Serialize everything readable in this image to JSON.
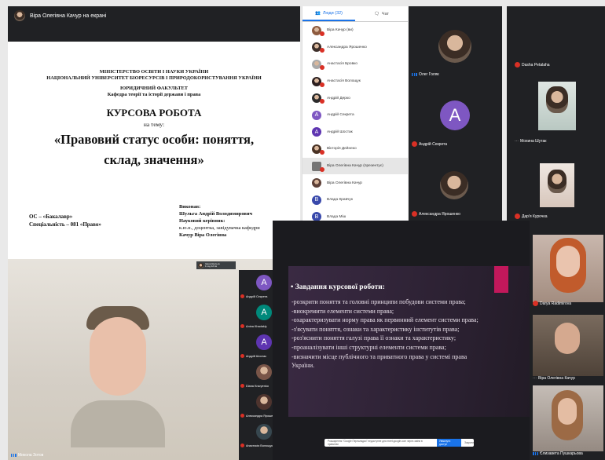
{
  "presenter": {
    "banner": "Віра Олегівна Качур на екрані"
  },
  "document": {
    "ministry": "МІНІСТЕРСТВО ОСВІТИ І НАУКИ УКРАЇНИ",
    "university": "НАЦІОНАЛЬНИЙ УНІВЕРСИТЕТ БІОРЕСУРСІВ І ПРИРОДОКОРИСТУВАННЯ УКРАЇНИ",
    "faculty": "ЮРИДИЧНИЙ ФАКУЛЬТЕТ",
    "department": "Кафедра теорії та історії держави і права",
    "work_type": "КУРСОВА РОБОТА",
    "on_topic": "на тему:",
    "topic_line1": "«Правовий статус особи: поняття,",
    "topic_line2": "склад, значення»",
    "degree": "ОС – «Бакалавр»",
    "specialty": "Спеціальність – 081 «Право»",
    "performed_label": "Виконав:",
    "student": "Шульга Андрій Володимирович",
    "supervisor_label": "Науковий керівник:",
    "supervisor_title": "к.ю.н., доцентка, завідувачка кафедри",
    "supervisor": "Качур Віра Олегівна"
  },
  "people_panel": {
    "tab_people": "Люди (32)",
    "tab_chat": "Чат",
    "items": [
      {
        "name": "Віра Качур (ви)",
        "type": "photo",
        "color": "#8d5b3f",
        "muted": true
      },
      {
        "name": "Александра Ярошенко",
        "type": "photo",
        "color": "#3d2f2a",
        "muted": true
      },
      {
        "name": "Анастасія Бровко",
        "type": "photo",
        "color": "#a9a9a9",
        "muted": true
      },
      {
        "name": "Анастасія Волощук",
        "type": "photo",
        "color": "#2d2020",
        "muted": true
      },
      {
        "name": "Андрій Дерко",
        "type": "photo",
        "color": "#2b2b2b",
        "muted": true
      },
      {
        "name": "Андрій Секрета",
        "type": "letter",
        "letter": "A",
        "color": "#7e57c2",
        "muted": true
      },
      {
        "name": "Андрій Шостак",
        "type": "letter",
        "letter": "A",
        "color": "#5e35b1",
        "muted": true
      },
      {
        "name": "Вікторія Дейнеко",
        "type": "photo",
        "color": "#4a3325",
        "muted": true
      },
      {
        "name": "Віра Олегівна Качур (презентує)",
        "type": "screen",
        "color": "#757575",
        "muted": true
      },
      {
        "name": "Віра Олегівна Качур",
        "type": "photo",
        "color": "#5d4037",
        "muted": false
      },
      {
        "name": "Влада Кравчук",
        "type": "letter",
        "letter": "B",
        "color": "#3949ab",
        "muted": true
      },
      {
        "name": "Влада Міш",
        "type": "letter",
        "letter": "B",
        "color": "#3949ab",
        "muted": true
      }
    ]
  },
  "grid_mid": {
    "tiles": [
      {
        "name": "Олег Голяк",
        "letter": "",
        "color": "#4e342e"
      },
      {
        "name": "Андрій Секрета",
        "letter": "A",
        "color": "#7e57c2"
      },
      {
        "name": "Александра Ярошенко",
        "letter": "",
        "color": "#3e2723"
      }
    ]
  },
  "grid_right": {
    "tiles": [
      {
        "name": "Dasha Petalaha"
      },
      {
        "name": "Мохина Шутак"
      },
      {
        "name": "Дар'я Курочка"
      }
    ]
  },
  "video_bl": {
    "participant": "Микола Зотов",
    "self_name": "Ірина Шульга",
    "self_time": "1 год 12 хв",
    "strip": [
      {
        "name": "Андрій Секрета",
        "letter": "A",
        "color": "#7e57c2"
      },
      {
        "name": "Аліна Khadakly",
        "letter": "A",
        "color": "#00897b"
      },
      {
        "name": "Андрій Шостак",
        "letter": "A",
        "color": "#5e35b1"
      },
      {
        "name": "Diana Kravyenko",
        "letter": "",
        "color": "#795548"
      },
      {
        "name": "Александра Ярошенко",
        "letter": "",
        "color": "#4e342e"
      },
      {
        "name": "Анастасія Волощук",
        "letter": "",
        "color": "#37474f"
      }
    ]
  },
  "slide": {
    "heading": "Завдання курсової роботи:",
    "items": [
      "-розкрити поняття та головні принципи побудови системи права;",
      "-виокремити елементи системи права;",
      "-охарактеризувати норму права як первинний елемент системи права;",
      "-з'ясувати поняття, ознаки та характеристику інститутів права;",
      "-роз'яснити поняття галузі права її ознаки та характеристику;",
      "-проаналізувати інші структурні елементи системи права;",
      "-визначити місце публічного та приватного права у системі права України."
    ],
    "snackbar_text": "Розширення \"Google Перекладач\" недоступне для meet.google.com через зміни в правилах",
    "snackbar_button": "Увімкнути доступ",
    "snackbar_dismiss": "Закрити",
    "accent_color": "#c2185b"
  },
  "col_right": {
    "tiles": [
      {
        "name": "Darya Radimirova"
      },
      {
        "name": "Віра Олегівна Качур"
      },
      {
        "name": "Єлизавета Пушкарьова"
      }
    ]
  }
}
